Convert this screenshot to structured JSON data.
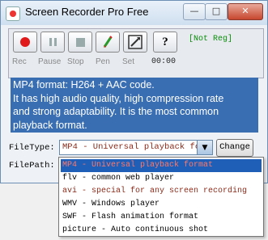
{
  "window": {
    "title": "Screen Recorder Pro Free",
    "controls": {
      "minimize": "—",
      "maximize": "□",
      "close": "✕"
    }
  },
  "toolbar": {
    "labels": [
      "Rec",
      "Pause",
      "Stop",
      "Pen",
      "Set"
    ],
    "timer": "00:00",
    "status": "[Not Reg]",
    "icons": [
      "record-icon",
      "pause-icon",
      "stop-icon",
      "pen-icon",
      "settings-icon",
      "help-icon"
    ]
  },
  "info": {
    "lines": [
      "MP4 format: H264 + AAC code.",
      "It has high audio quality, high compression rate",
      "and strong adaptability. It is the most common",
      "playback format."
    ]
  },
  "form": {
    "filetype_label": "FileType:",
    "filepath_label": "FilePath:",
    "filetype_value": "MP4 - Universal playback format",
    "change_label": "Change"
  },
  "dropdown": {
    "options": [
      "MP4 - Universal playback format",
      "flv - common web player",
      "avi - special for any screen recording",
      "WMV - Windows player",
      "SWF - Flash animation format",
      "picture - Auto continuous shot"
    ],
    "selected": "MP4 - Universal playback format"
  },
  "colors": {
    "accent": "#3a6eb2",
    "selection": "#1f5fb8",
    "record": "#e01a1a",
    "status": "#0a8a0a"
  }
}
